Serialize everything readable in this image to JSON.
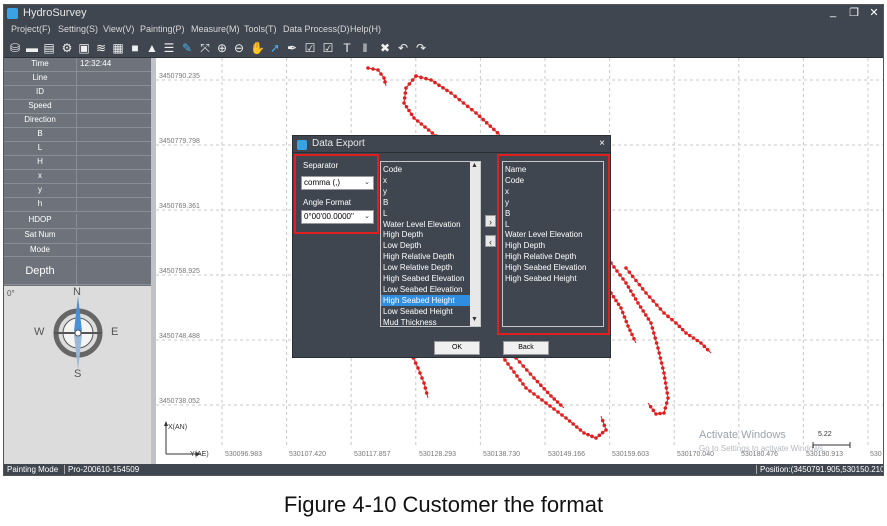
{
  "app": {
    "title": "HydroSurvey"
  },
  "window_controls": {
    "minimize": "_",
    "restore": "❐",
    "close": "✕"
  },
  "menu": [
    "Project(F)",
    "Setting(S)",
    "View(V)",
    "Painting(P)",
    "Measure(M)",
    "Tools(T)",
    "Data Process(D)",
    "Help(H)"
  ],
  "toolbar_icons": [
    "usb-icon",
    "folder-open-icon",
    "database-icon",
    "gear-icon",
    "chart-icon",
    "wave-icon",
    "document-icon",
    "camera-icon",
    "ship-icon",
    "edit-icon",
    "fit-extent-icon",
    "zoom-in-icon",
    "zoom-out-icon",
    "pan-hand-icon",
    "pointer-icon",
    "measure-icon",
    "edit-note-icon",
    "checklist-icon",
    "text-icon",
    "barcode-icon",
    "delete-icon",
    "undo-icon",
    "redo-icon"
  ],
  "sidebar": {
    "fields": [
      {
        "label": "Time",
        "value": "12:32:44"
      },
      {
        "label": "Line",
        "value": ""
      },
      {
        "label": "ID",
        "value": ""
      },
      {
        "label": "Speed",
        "value": ""
      },
      {
        "label": "Direction",
        "value": ""
      },
      {
        "label": "B",
        "value": ""
      },
      {
        "label": "L",
        "value": ""
      },
      {
        "label": "H",
        "value": ""
      },
      {
        "label": "x",
        "value": ""
      },
      {
        "label": "y",
        "value": ""
      },
      {
        "label": "h",
        "value": ""
      },
      {
        "label": "HDOP",
        "value": ""
      },
      {
        "label": "Sat Num",
        "value": ""
      },
      {
        "label": "Mode",
        "value": ""
      }
    ],
    "depth_label": "Depth",
    "heading": "0°",
    "compass": {
      "n": "N",
      "s": "S",
      "e": "E",
      "w": "W"
    }
  },
  "plot": {
    "y_ticks": [
      "3450790.235",
      "3450779.798",
      "3450769.361",
      "3450758.925",
      "3450748.488",
      "3450738.052"
    ],
    "x_ticks": [
      "530096.983",
      "530107.420",
      "530117.857",
      "530128.293",
      "530138.730",
      "530149.166",
      "530159.603",
      "530170.040",
      "530180.476",
      "530190.913",
      "530"
    ],
    "axis_y_label": "X(AN)",
    "axis_x_label": "Y(AE)",
    "track_color": "#e02020",
    "scale_value": "5.22"
  },
  "watermark": {
    "line1": "Activate Windows",
    "line2": "Go to Settings to activate Windows."
  },
  "status": {
    "mode": "Painting Mode",
    "project": "Pro-200610-154509",
    "position": "Position:(3450791.905,530150.210)"
  },
  "dialog": {
    "title": "Data Export",
    "separator_label": "Separator",
    "separator_value": "comma  (,)",
    "angle_label": "Angle Format",
    "angle_value": "0°00'00.0000\"",
    "available_fields": [
      "Code",
      "x",
      "y",
      "B",
      "L",
      "Water Level Elevation",
      "High Depth",
      "Low Depth",
      "High Relative Depth",
      "Low Relative Depth",
      "High Seabed Elevation",
      "Low Seabed Elevation",
      "High Seabed Height",
      "Low Seabed Height",
      "Mud Thickness"
    ],
    "selected_index": 12,
    "export_fields": [
      "Name",
      "Code",
      "x",
      "y",
      "B",
      "L",
      "Water Level Elevation",
      "High Depth",
      "High Relative Depth",
      "High Seabed Elevation",
      "High Seabed Height"
    ],
    "add_arrow": "›",
    "remove_arrow": "‹",
    "ok_label": "OK",
    "back_label": "Back",
    "close_glyph": "×",
    "highlight_color": "#e02020"
  },
  "caption": "Figure 4-10 Customer the format"
}
